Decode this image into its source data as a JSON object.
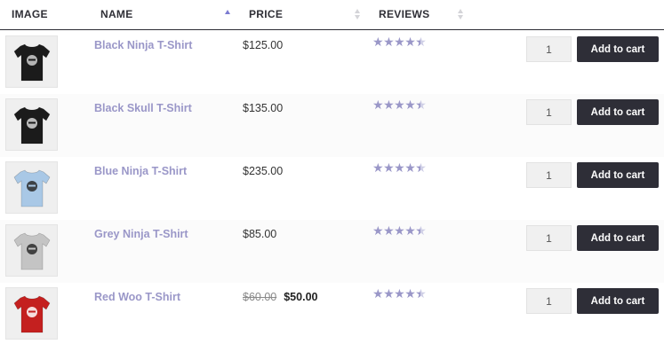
{
  "header": {
    "image": "IMAGE",
    "name": "NAME",
    "price": "PRICE",
    "reviews": "REVIEWS"
  },
  "rating_value": 4.5,
  "rating_max": 5,
  "add_to_cart_label": "Add to cart",
  "colors": {
    "link": "#9a97c8",
    "button": "#2e2e37",
    "sort_active": "#7b7bd1"
  },
  "products": [
    {
      "name": "Black Ninja T-Shirt",
      "price": "$125.00",
      "sale_price": "",
      "qty": "1",
      "shirt_color": "#1b1b1b",
      "print_color": "#cfcfcf"
    },
    {
      "name": "Black Skull T-Shirt",
      "price": "$135.00",
      "sale_price": "",
      "qty": "1",
      "shirt_color": "#1b1b1b",
      "print_color": "#d8d8d8"
    },
    {
      "name": "Blue Ninja T-Shirt",
      "price": "$235.00",
      "sale_price": "",
      "qty": "1",
      "shirt_color": "#a9c8e6",
      "print_color": "#2a2a2a"
    },
    {
      "name": "Grey Ninja T-Shirt",
      "price": "$85.00",
      "sale_price": "",
      "qty": "1",
      "shirt_color": "#c4c4c4",
      "print_color": "#2a2a2a"
    },
    {
      "name": "Red Woo T-Shirt",
      "price": "$60.00",
      "sale_price": "$50.00",
      "qty": "1",
      "shirt_color": "#c4201f",
      "print_color": "#ffffff"
    }
  ]
}
